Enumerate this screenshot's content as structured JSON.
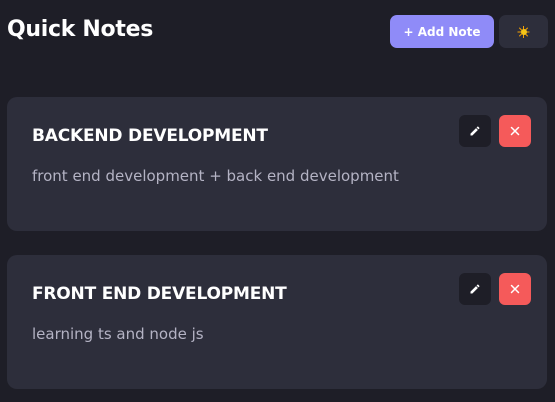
{
  "header": {
    "title": "Quick Notes",
    "add_label": "+ Add Note",
    "theme_icon": "sun-icon"
  },
  "notes": [
    {
      "title": "BACKEND DEVELOPMENT",
      "body": "front end development + back end development"
    },
    {
      "title": "FRONT END DEVELOPMENT",
      "body": "learning ts and node js"
    }
  ],
  "colors": {
    "background": "#1e1e27",
    "card": "#2d2e3b",
    "accent": "#8f8bf8",
    "danger": "#f55a5a",
    "body_text": "#b4b3c4"
  }
}
